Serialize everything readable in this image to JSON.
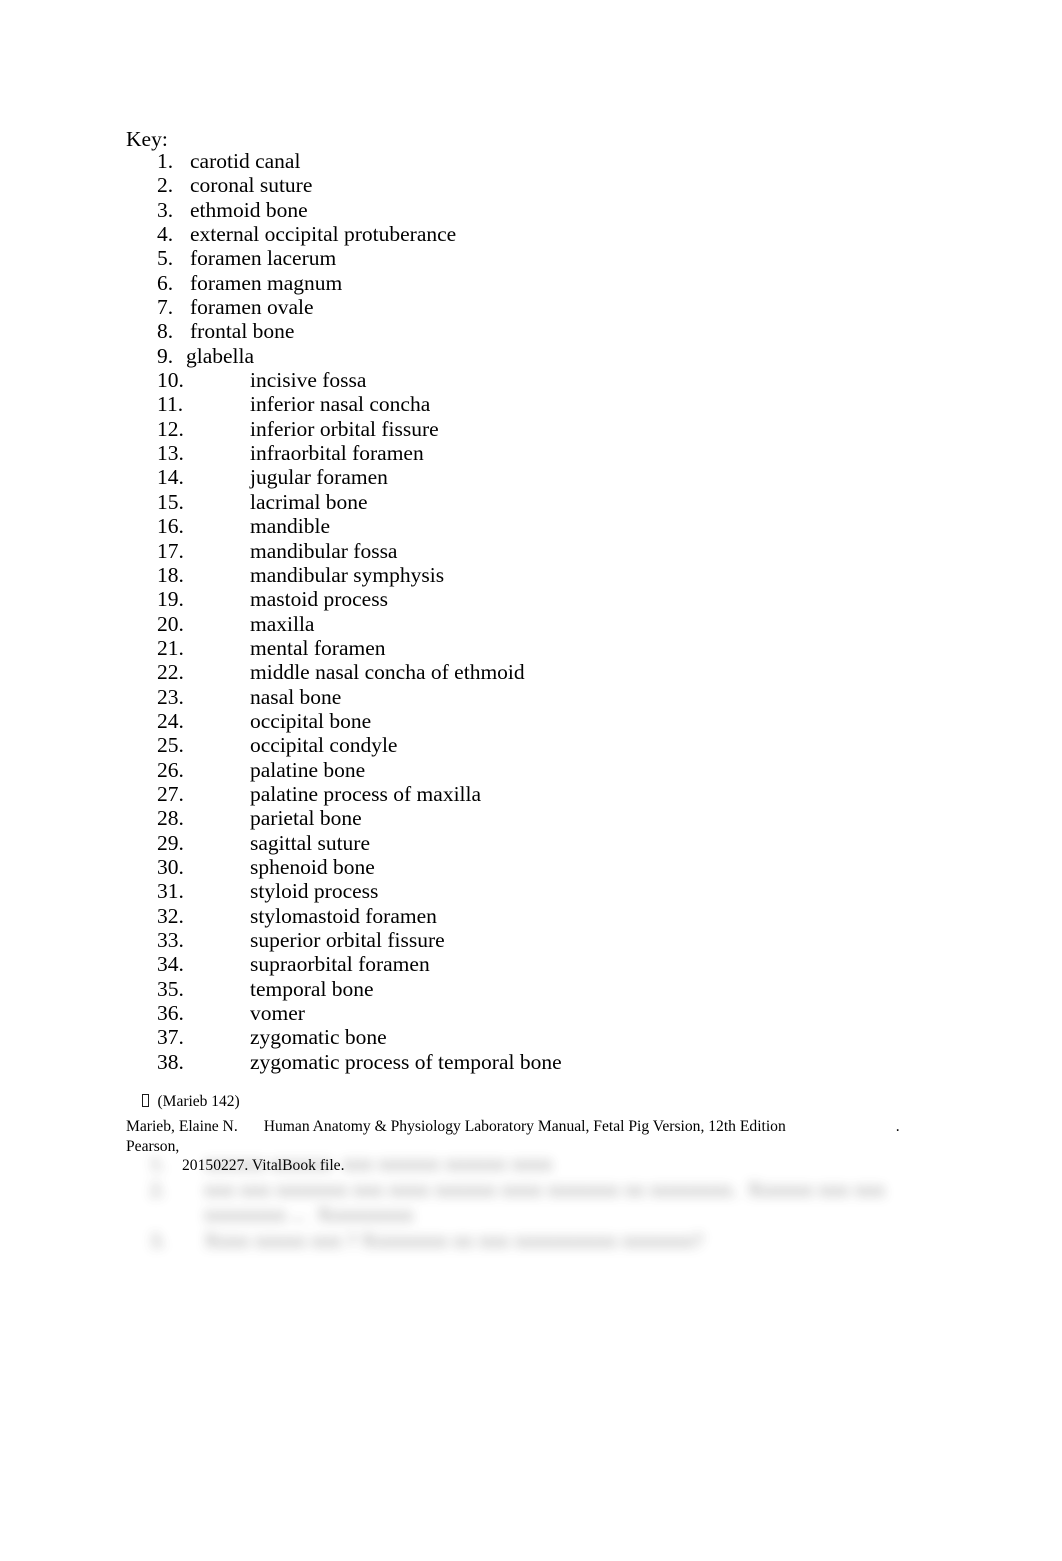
{
  "document": {
    "heading": "Key:",
    "items": [
      {
        "number": "1.",
        "label": "carotid canal"
      },
      {
        "number": "2.",
        "label": "coronal suture"
      },
      {
        "number": "3.",
        "label": "ethmoid bone"
      },
      {
        "number": "4.",
        "label": "external occipital protuberance"
      },
      {
        "number": "5.",
        "label": "foramen lacerum"
      },
      {
        "number": "6.",
        "label": "foramen magnum"
      },
      {
        "number": "7.",
        "label": "foramen ovale"
      },
      {
        "number": "8.",
        "label": "frontal bone"
      },
      {
        "number": "9.",
        "label": "glabella"
      },
      {
        "number": "10.",
        "label": "incisive fossa"
      },
      {
        "number": "11.",
        "label": "inferior nasal concha"
      },
      {
        "number": "12.",
        "label": "inferior orbital fissure"
      },
      {
        "number": "13.",
        "label": "infraorbital foramen"
      },
      {
        "number": "14.",
        "label": "jugular foramen"
      },
      {
        "number": "15.",
        "label": "lacrimal bone"
      },
      {
        "number": "16.",
        "label": "mandible"
      },
      {
        "number": "17.",
        "label": "mandibular fossa"
      },
      {
        "number": "18.",
        "label": "mandibular symphysis"
      },
      {
        "number": "19.",
        "label": "mastoid process"
      },
      {
        "number": "20.",
        "label": "maxilla"
      },
      {
        "number": "21.",
        "label": "mental foramen"
      },
      {
        "number": "22.",
        "label": "middle nasal concha of ethmoid"
      },
      {
        "number": "23.",
        "label": "nasal bone"
      },
      {
        "number": "24.",
        "label": "occipital bone"
      },
      {
        "number": "25.",
        "label": "occipital condyle"
      },
      {
        "number": "26.",
        "label": "palatine bone"
      },
      {
        "number": "27.",
        "label": "palatine process of maxilla"
      },
      {
        "number": "28.",
        "label": "parietal bone"
      },
      {
        "number": "29.",
        "label": "sagittal suture"
      },
      {
        "number": "30.",
        "label": "sphenoid bone"
      },
      {
        "number": "31.",
        "label": "styloid process"
      },
      {
        "number": "32.",
        "label": "stylomastoid foramen"
      },
      {
        "number": "33.",
        "label": "superior orbital fissure"
      },
      {
        "number": "34.",
        "label": "supraorbital foramen"
      },
      {
        "number": "35.",
        "label": "temporal bone"
      },
      {
        "number": "36.",
        "label": "vomer"
      },
      {
        "number": "37.",
        "label": "zygomatic bone"
      },
      {
        "number": "38.",
        "label": "zygomatic process of temporal bone"
      }
    ],
    "source_marker": {
      "missing_glyph_icon": "missing-glyph-box",
      "text": "(Marieb 142)"
    },
    "citation": {
      "author": "Marieb, Elaine N.",
      "title": "Human Anatomy & Physiology Laboratory Manual, Fetal Pig Version, 12th Edition",
      "publisher": ". Pearson,",
      "date_and_format": "20150227. VitalBook file."
    },
    "obscured_content": {
      "note": "blurred, illegible",
      "rows": [
        {
          "number": "1.",
          "text": "xxxxxx xxxxxx  xxx xxxxxx xxxxxx xxxx"
        },
        {
          "number": "2.",
          "text": "xxx xxx xxxxxxx xxx xxxx xxxxxx xxxx xxxxxxx xx xxxxxxxx.  Xxxxxx xxx xxx xxxxxxxx ...  Xxxxxxxxx"
        },
        {
          "number": "3.",
          "text": "Xxxx xxxxx xxx ? Xxxxxxxx xx xxx xxxxxxxxxx xxxxxxx?"
        }
      ]
    }
  }
}
